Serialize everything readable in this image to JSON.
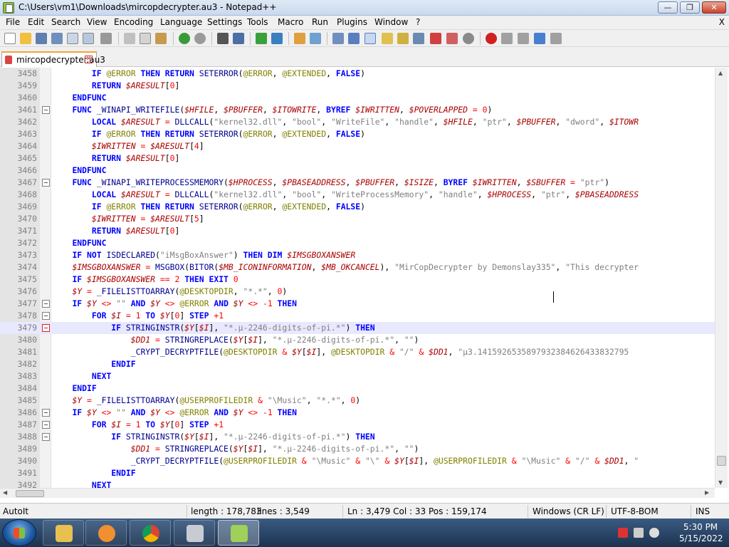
{
  "window": {
    "title": "C:\\Users\\vm1\\Downloads\\mircopdecrypter.au3 - Notepad++",
    "minimize": "—",
    "maximize": "❐",
    "close": "✕"
  },
  "menu": {
    "items": [
      "File",
      "Edit",
      "Search",
      "View",
      "Encoding",
      "Language",
      "Settings",
      "Tools",
      "Macro",
      "Run",
      "Plugins",
      "Window",
      "?"
    ],
    "close_doc": "X"
  },
  "tab": {
    "name": "mircopdecrypter.au3",
    "close": "✕"
  },
  "editor": {
    "current_line": "3479",
    "lines": [
      {
        "n": "3458",
        "html": "        <span class='kw'>IF</span> <span class='mac'>@ERROR</span> <span class='kw'>THEN</span> <span class='kw'>RETURN</span> <span class='fn'>SETERROR</span>(<span class='mac'>@ERROR</span>, <span class='mac'>@EXTENDED</span>, <span class='kw'>FALSE</span>)"
      },
      {
        "n": "3459",
        "html": "        <span class='kw'>RETURN</span> <span class='var'>$ARESULT</span>[<span class='num'>0</span>]"
      },
      {
        "n": "3460",
        "html": "    <span class='kw'>ENDFUNC</span>"
      },
      {
        "n": "3461",
        "fold": true,
        "html": "    <span class='kw'>FUNC</span> <span class='fn'>_WINAPI_WRITEFILE</span>(<span class='var'>$HFILE</span>, <span class='var'>$PBUFFER</span>, <span class='var'>$ITOWRITE</span>, <span class='kw'>BYREF</span> <span class='var'>$IWRITTEN</span>, <span class='var'>$POVERLAPPED</span> <span class='op'>=</span> <span class='num'>0</span>)"
      },
      {
        "n": "3462",
        "html": "        <span class='kw'>LOCAL</span> <span class='var'>$ARESULT</span> <span class='op'>=</span> <span class='fn'>DLLCALL</span>(<span class='str'>\"kernel32.dll\"</span>, <span class='str'>\"bool\"</span>, <span class='str'>\"WriteFile\"</span>, <span class='str'>\"handle\"</span>, <span class='var'>$HFILE</span>, <span class='str'>\"ptr\"</span>, <span class='var'>$PBUFFER</span>, <span class='str'>\"dword\"</span>, <span class='var'>$ITOWR</span>"
      },
      {
        "n": "3463",
        "html": "        <span class='kw'>IF</span> <span class='mac'>@ERROR</span> <span class='kw'>THEN</span> <span class='kw'>RETURN</span> <span class='fn'>SETERROR</span>(<span class='mac'>@ERROR</span>, <span class='mac'>@EXTENDED</span>, <span class='kw'>FALSE</span>)"
      },
      {
        "n": "3464",
        "html": "        <span class='var'>$IWRITTEN</span> <span class='op'>=</span> <span class='var'>$ARESULT</span>[<span class='num'>4</span>]"
      },
      {
        "n": "3465",
        "html": "        <span class='kw'>RETURN</span> <span class='var'>$ARESULT</span>[<span class='num'>0</span>]"
      },
      {
        "n": "3466",
        "html": "    <span class='kw'>ENDFUNC</span>"
      },
      {
        "n": "3467",
        "fold": true,
        "html": "    <span class='kw'>FUNC</span> <span class='fn'>_WINAPI_WRITEPROCESSMEMORY</span>(<span class='var'>$HPROCESS</span>, <span class='var'>$PBASEADDRESS</span>, <span class='var'>$PBUFFER</span>, <span class='var'>$ISIZE</span>, <span class='kw'>BYREF</span> <span class='var'>$IWRITTEN</span>, <span class='var'>$SBUFFER</span> <span class='op'>=</span> <span class='str'>\"ptr\"</span>)"
      },
      {
        "n": "3468",
        "html": "        <span class='kw'>LOCAL</span> <span class='var'>$ARESULT</span> <span class='op'>=</span> <span class='fn'>DLLCALL</span>(<span class='str'>\"kernel32.dll\"</span>, <span class='str'>\"bool\"</span>, <span class='str'>\"WriteProcessMemory\"</span>, <span class='str'>\"handle\"</span>, <span class='var'>$HPROCESS</span>, <span class='str'>\"ptr\"</span>, <span class='var'>$PBASEADDRESS</span>"
      },
      {
        "n": "3469",
        "html": "        <span class='kw'>IF</span> <span class='mac'>@ERROR</span> <span class='kw'>THEN</span> <span class='kw'>RETURN</span> <span class='fn'>SETERROR</span>(<span class='mac'>@ERROR</span>, <span class='mac'>@EXTENDED</span>, <span class='kw'>FALSE</span>)"
      },
      {
        "n": "3470",
        "html": "        <span class='var'>$IWRITTEN</span> <span class='op'>=</span> <span class='var'>$ARESULT</span>[<span class='num'>5</span>]"
      },
      {
        "n": "3471",
        "html": "        <span class='kw'>RETURN</span> <span class='var'>$ARESULT</span>[<span class='num'>0</span>]"
      },
      {
        "n": "3472",
        "html": "    <span class='kw'>ENDFUNC</span>"
      },
      {
        "n": "3473",
        "html": "    <span class='kw'>IF</span> <span class='kw'>NOT</span> <span class='fn'>ISDECLARED</span>(<span class='str'>\"iMsgBoxAnswer\"</span>) <span class='kw'>THEN</span> <span class='kw'>DIM</span> <span class='var'>$IMSGBOXANSWER</span>"
      },
      {
        "n": "3474",
        "html": "    <span class='var'>$IMSGBOXANSWER</span> <span class='op'>=</span> <span class='fn'>MSGBOX</span>(<span class='fn'>BITOR</span>(<span class='var'>$MB_ICONINFORMATION</span>, <span class='var'>$MB_OKCANCEL</span>), <span class='str'>\"MirCopDecrypter by Demonslay335\"</span>, <span class='str'>\"This decrypter</span>"
      },
      {
        "n": "3475",
        "html": "    <span class='kw'>IF</span> <span class='var'>$IMSGBOXANSWER</span> <span class='op'>==</span> <span class='num'>2</span> <span class='kw'>THEN</span> <span class='kw'>EXIT</span> <span class='num'>0</span>"
      },
      {
        "n": "3476",
        "html": "    <span class='var'>$Y</span> <span class='op'>=</span> <span class='fn'>_FILELISTTOARRAY</span>(<span class='mac'>@DESKTOPDIR</span>, <span class='str'>\"*.*\"</span>, <span class='num'>0</span>)"
      },
      {
        "n": "3477",
        "fold": true,
        "html": "    <span class='kw'>IF</span> <span class='var'>$Y</span> <span class='op'>&lt;&gt;</span> <span class='str'>\"\"</span> <span class='kw'>AND</span> <span class='var'>$Y</span> <span class='op'>&lt;&gt;</span> <span class='mac'>@ERROR</span> <span class='kw'>AND</span> <span class='var'>$Y</span> <span class='op'>&lt;&gt;</span> <span class='op'>-</span><span class='num'>1</span> <span class='kw'>THEN</span>"
      },
      {
        "n": "3478",
        "fold": true,
        "html": "        <span class='kw'>FOR</span> <span class='var'>$I</span> <span class='op'>=</span> <span class='num'>1</span> <span class='kw'>TO</span> <span class='var'>$Y</span>[<span class='num'>0</span>] <span class='kw'>STEP</span> <span class='op'>+</span><span class='num'>1</span>"
      },
      {
        "n": "3479",
        "fold": true,
        "red": true,
        "html": "            <span class='kw'>IF</span> <span class='fn'>STRINGINSTR</span>(<span class='var'>$Y</span>[<span class='var'>$I</span>], <span class='str'>\"*.µ-2246-digits-of-pi.*\"</span>) <span class='kw'>THEN</span>"
      },
      {
        "n": "3480",
        "html": "                <span class='var'>$DD1</span> <span class='op'>=</span> <span class='fn'>STRINGREPLACE</span>(<span class='var'>$Y</span>[<span class='var'>$I</span>], <span class='str'>\"*.µ-2246-digits-of-pi.*\"</span>, <span class='str'>\"\"</span>)"
      },
      {
        "n": "3481",
        "html": "                <span class='fn'>_CRYPT_DECRYPTFILE</span>(<span class='mac'>@DESKTOPDIR</span> <span class='op'>&amp;</span> <span class='var'>$Y</span>[<span class='var'>$I</span>], <span class='mac'>@DESKTOPDIR</span> <span class='op'>&amp;</span> <span class='str'>\"/\"</span> <span class='op'>&amp;</span> <span class='var'>$DD1</span>, <span class='str'>\"µ3.1415926535897932384626433832795</span>"
      },
      {
        "n": "3482",
        "html": "            <span class='kw'>ENDIF</span>"
      },
      {
        "n": "3483",
        "html": "        <span class='kw'>NEXT</span>"
      },
      {
        "n": "3484",
        "html": "    <span class='kw'>ENDIF</span>"
      },
      {
        "n": "3485",
        "html": "    <span class='var'>$Y</span> <span class='op'>=</span> <span class='fn'>_FILELISTTOARRAY</span>(<span class='mac'>@USERPROFILEDIR</span> <span class='op'>&amp;</span> <span class='str'>\"\\Music\"</span>, <span class='str'>\"*.*\"</span>, <span class='num'>0</span>)"
      },
      {
        "n": "3486",
        "fold": true,
        "html": "    <span class='kw'>IF</span> <span class='var'>$Y</span> <span class='op'>&lt;&gt;</span> <span class='str'>\"\"</span> <span class='kw'>AND</span> <span class='var'>$Y</span> <span class='op'>&lt;&gt;</span> <span class='mac'>@ERROR</span> <span class='kw'>AND</span> <span class='var'>$Y</span> <span class='op'>&lt;&gt;</span> <span class='op'>-</span><span class='num'>1</span> <span class='kw'>THEN</span>"
      },
      {
        "n": "3487",
        "fold": true,
        "html": "        <span class='kw'>FOR</span> <span class='var'>$I</span> <span class='op'>=</span> <span class='num'>1</span> <span class='kw'>TO</span> <span class='var'>$Y</span>[<span class='num'>0</span>] <span class='kw'>STEP</span> <span class='op'>+</span><span class='num'>1</span>"
      },
      {
        "n": "3488",
        "fold": true,
        "html": "            <span class='kw'>IF</span> <span class='fn'>STRINGINSTR</span>(<span class='var'>$Y</span>[<span class='var'>$I</span>], <span class='str'>\"*.µ-2246-digits-of-pi.*\"</span>) <span class='kw'>THEN</span>"
      },
      {
        "n": "3489",
        "html": "                <span class='var'>$DD1</span> <span class='op'>=</span> <span class='fn'>STRINGREPLACE</span>(<span class='var'>$Y</span>[<span class='var'>$I</span>], <span class='str'>\"*.µ-2246-digits-of-pi.*\"</span>, <span class='str'>\"\"</span>)"
      },
      {
        "n": "3490",
        "html": "                <span class='fn'>_CRYPT_DECRYPTFILE</span>(<span class='mac'>@USERPROFILEDIR</span> <span class='op'>&amp;</span> <span class='str'>\"\\Music\"</span> <span class='op'>&amp;</span> <span class='str'>\"\\\"</span> <span class='op'>&amp;</span> <span class='var'>$Y</span>[<span class='var'>$I</span>], <span class='mac'>@USERPROFILEDIR</span> <span class='op'>&amp;</span> <span class='str'>\"\\Music\"</span> <span class='op'>&amp;</span> <span class='str'>\"/\"</span> <span class='op'>&amp;</span> <span class='var'>$DD1</span>, <span class='str'>\"</span>"
      },
      {
        "n": "3491",
        "html": "            <span class='kw'>ENDIF</span>"
      },
      {
        "n": "3492",
        "html": "        <span class='kw'>NEXT</span>"
      }
    ]
  },
  "status": {
    "language": "AutoIt",
    "length": "length : 178,783",
    "lines": "lines : 3,549",
    "position": "Ln : 3,479    Col : 33    Pos : 159,174",
    "eol": "Windows (CR LF)",
    "encoding": "UTF-8-BOM",
    "mode": "INS"
  },
  "taskbar": {
    "time": "5:30 PM",
    "date": "5/15/2022"
  }
}
